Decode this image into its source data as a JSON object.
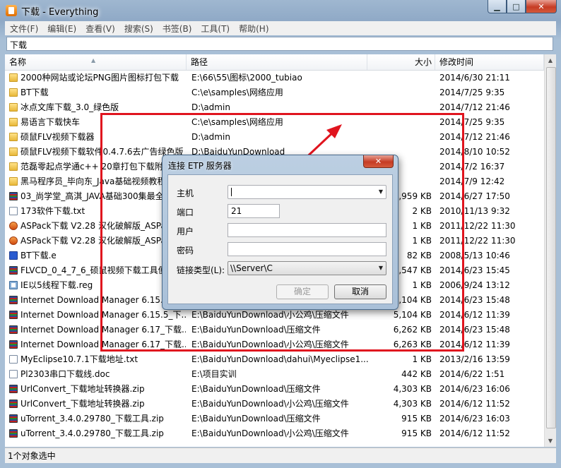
{
  "window": {
    "title": "下载 - Everything",
    "minimize": "▁",
    "maximize": "□",
    "close": "✕"
  },
  "menu": [
    "文件(F)",
    "编辑(E)",
    "查看(V)",
    "搜索(S)",
    "书签(B)",
    "工具(T)",
    "帮助(H)"
  ],
  "search": {
    "value": "下载"
  },
  "columns": {
    "name": "名称",
    "path": "路径",
    "size": "大小",
    "date": "修改时间"
  },
  "rows": [
    {
      "icon": "folder",
      "name": "2000种网站或论坛PNG图片图标打包下载",
      "path": "E:\\66\\55\\图标\\2000_tubiao",
      "size": "",
      "date": "2014/6/30 21:11"
    },
    {
      "icon": "folder",
      "name": "BT下载",
      "path": "C:\\e\\samples\\网络应用",
      "size": "",
      "date": "2014/7/25 9:35"
    },
    {
      "icon": "folder",
      "name": "冰点文库下载_3.0_绿色版",
      "path": "D:\\admin",
      "size": "",
      "date": "2014/7/12 21:46"
    },
    {
      "icon": "folder",
      "name": "易语言下载快车",
      "path": "C:\\e\\samples\\网络应用",
      "size": "",
      "date": "2014/7/25 9:35"
    },
    {
      "icon": "folder",
      "name": "硕鼠FLV视频下载器",
      "path": "D:\\admin",
      "size": "",
      "date": "2014/7/12 21:46"
    },
    {
      "icon": "folder",
      "name": "硕鼠FLV视频下载软件0.4.7.6去广告绿色版",
      "path": "D:\\BaiduYunDownload",
      "size": "",
      "date": "2014/8/10 10:52"
    },
    {
      "icon": "folder",
      "name": "范磊零起点学通c++ 20章打包下载附",
      "path": "",
      "size": "",
      "date": "2014/7/2 16:37"
    },
    {
      "icon": "folder",
      "name": "黑马程序员_毕向东_Java基础视频教程",
      "path": "",
      "size": "",
      "date": "2014/7/9 12:42"
    },
    {
      "icon": "zip",
      "name": "03_尚学堂_高淇_JAVA基础300集最全",
      "path": "",
      "size": "2,959 KB",
      "date": "2014/6/27 17:50"
    },
    {
      "icon": "doc",
      "name": "173软件下载.txt",
      "path": "",
      "size": "2 KB",
      "date": "2010/11/13 9:32"
    },
    {
      "icon": "exe",
      "name": "ASPack下载 V2.28 汉化破解版_ASPa",
      "path": "",
      "size": "1 KB",
      "date": "2011/12/22 11:30"
    },
    {
      "icon": "exe",
      "name": "ASPack下载 V2.28 汉化破解版_ASPa",
      "path": "",
      "size": "1 KB",
      "date": "2011/12/22 11:30"
    },
    {
      "icon": "e",
      "name": "BT下载.e",
      "path": "",
      "size": "82 KB",
      "date": "2008/5/13 10:46"
    },
    {
      "icon": "zip",
      "name": "FLVCD_0_4_7_6_硕鼠视频下载工具便",
      "path": "",
      "size": "7,547 KB",
      "date": "2014/6/23 15:45"
    },
    {
      "icon": "reg",
      "name": "IE以5线程下载.reg",
      "path": "",
      "size": "1 KB",
      "date": "2006/9/24 13:12"
    },
    {
      "icon": "zip",
      "name": "Internet Download Manager 6.15.5",
      "path": "",
      "size": "5,104 KB",
      "date": "2014/6/23 15:48"
    },
    {
      "icon": "zip",
      "name": "Internet Download Manager 6.15.5_下...",
      "path": "E:\\BaiduYunDownload\\小公鸡\\压缩文件",
      "size": "5,104 KB",
      "date": "2014/6/12 11:39"
    },
    {
      "icon": "zip",
      "name": "Internet Download Manager 6.17_下载...",
      "path": "E:\\BaiduYunDownload\\压缩文件",
      "size": "6,262 KB",
      "date": "2014/6/23 15:48"
    },
    {
      "icon": "zip",
      "name": "Internet Download Manager 6.17_下载...",
      "path": "E:\\BaiduYunDownload\\小公鸡\\压缩文件",
      "size": "6,263 KB",
      "date": "2014/6/12 11:39"
    },
    {
      "icon": "doc",
      "name": "MyEclipse10.7.1下载地址.txt",
      "path": "E:\\BaiduYunDownload\\dahui\\Myeclipse1...",
      "size": "1 KB",
      "date": "2013/2/16 13:59"
    },
    {
      "icon": "doc",
      "name": "Pl2303串口下载线.doc",
      "path": "E:\\项目实训",
      "size": "442 KB",
      "date": "2014/6/22 1:51"
    },
    {
      "icon": "zip",
      "name": "UrlConvert_下载地址转换器.zip",
      "path": "E:\\BaiduYunDownload\\压缩文件",
      "size": "4,303 KB",
      "date": "2014/6/23 16:06"
    },
    {
      "icon": "zip",
      "name": "UrlConvert_下载地址转换器.zip",
      "path": "E:\\BaiduYunDownload\\小公鸡\\压缩文件",
      "size": "4,303 KB",
      "date": "2014/6/12 11:52"
    },
    {
      "icon": "zip",
      "name": "uTorrent_3.4.0.29780_下载工具.zip",
      "path": "E:\\BaiduYunDownload\\压缩文件",
      "size": "915 KB",
      "date": "2014/6/23 16:03"
    },
    {
      "icon": "zip",
      "name": "uTorrent_3.4.0.29780_下载工具.zip",
      "path": "E:\\BaiduYunDownload\\小公鸡\\压缩文件",
      "size": "915 KB",
      "date": "2014/6/12 11:52"
    }
  ],
  "status": "1个对象选中",
  "dialog": {
    "title": "连接 ETP 服务器",
    "close": "✕",
    "host_label": "主机",
    "host_value": "",
    "port_label": "端口",
    "port_value": "21",
    "user_label": "用户",
    "user_value": "",
    "pass_label": "密码",
    "pass_value": "",
    "link_type_label": "链接类型(L):",
    "link_type_value": "\\\\Server\\C",
    "ok_label": "确定",
    "cancel_label": "取消"
  },
  "annotation_color": "#e0141e"
}
